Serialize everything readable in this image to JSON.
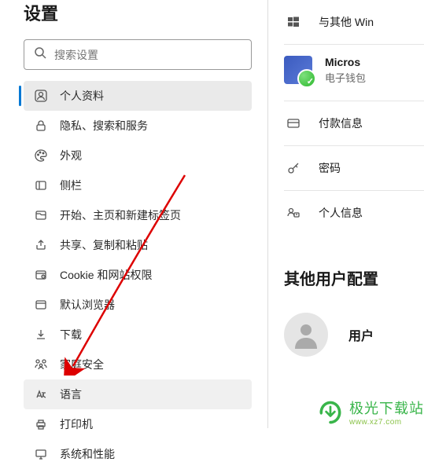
{
  "sidebar": {
    "title": "设置",
    "search_placeholder": "搜索设置",
    "items": [
      {
        "label": "个人资料"
      },
      {
        "label": "隐私、搜索和服务"
      },
      {
        "label": "外观"
      },
      {
        "label": "侧栏"
      },
      {
        "label": "开始、主页和新建标签页"
      },
      {
        "label": "共享、复制和粘贴"
      },
      {
        "label": "Cookie 和网站权限"
      },
      {
        "label": "默认浏览器"
      },
      {
        "label": "下载"
      },
      {
        "label": "家庭安全"
      },
      {
        "label": "语言"
      },
      {
        "label": "打印机"
      },
      {
        "label": "系统和性能"
      }
    ]
  },
  "right": {
    "sync": "与其他 Win",
    "ms_title": "Micros",
    "ms_sub": "电子钱包",
    "rows": [
      {
        "label": "付款信息"
      },
      {
        "label": "密码"
      },
      {
        "label": "个人信息"
      }
    ],
    "section_title": "其他用户配置",
    "user_label": "用户"
  },
  "watermark": {
    "text": "极光下载站",
    "sub": "www.xz7.com"
  }
}
